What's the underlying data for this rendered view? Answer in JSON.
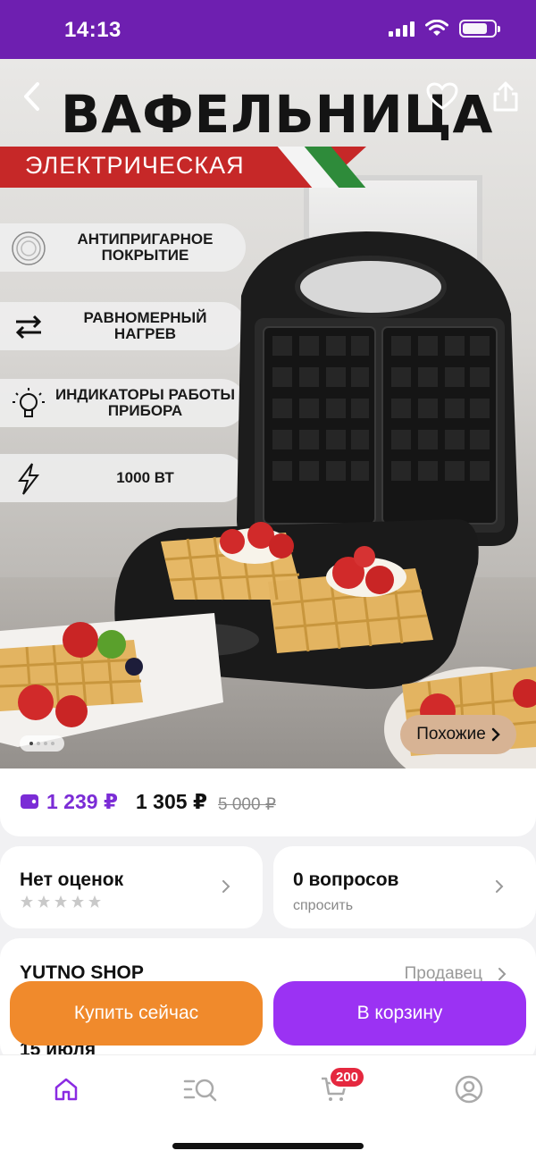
{
  "status_bar": {
    "time": "14:13"
  },
  "hero": {
    "title": "ВАФЕЛЬНИЦА",
    "subtitle": "ЭЛЕКТРИЧЕСКАЯ",
    "features": [
      {
        "icon": "coating-icon",
        "text": "АНТИПРИГАРНОЕ ПОКРЫТИЕ"
      },
      {
        "icon": "arrows-icon",
        "text": "РАВНОМЕРНЫЙ НАГРЕВ"
      },
      {
        "icon": "bulb-icon",
        "text": "ИНДИКАТОРЫ РАБОТЫ ПРИБОРА"
      },
      {
        "icon": "lightning-icon",
        "text": "1000 ВТ"
      }
    ],
    "similar_label": "Похожие"
  },
  "price": {
    "main": "1 239 ₽",
    "secondary": "1 305 ₽",
    "old": "5 000 ₽",
    "accent_color": "#7b2cd6"
  },
  "reviews": {
    "title": "Нет оценок"
  },
  "questions": {
    "title": "0 вопросов",
    "subtitle": "спросить"
  },
  "seller": {
    "name": "YUTNO SHOP",
    "role": "Продавец"
  },
  "delivery": {
    "date": "15 июля"
  },
  "actions": {
    "buy_now": "Купить сейчас",
    "add_to_cart": "В корзину",
    "buy_color": "#f08a2c",
    "cart_color": "#9b32f3"
  },
  "tabbar": {
    "items": [
      "home-icon",
      "catalog-search-icon",
      "cart-icon",
      "profile-icon"
    ],
    "cart_badge": "200"
  }
}
